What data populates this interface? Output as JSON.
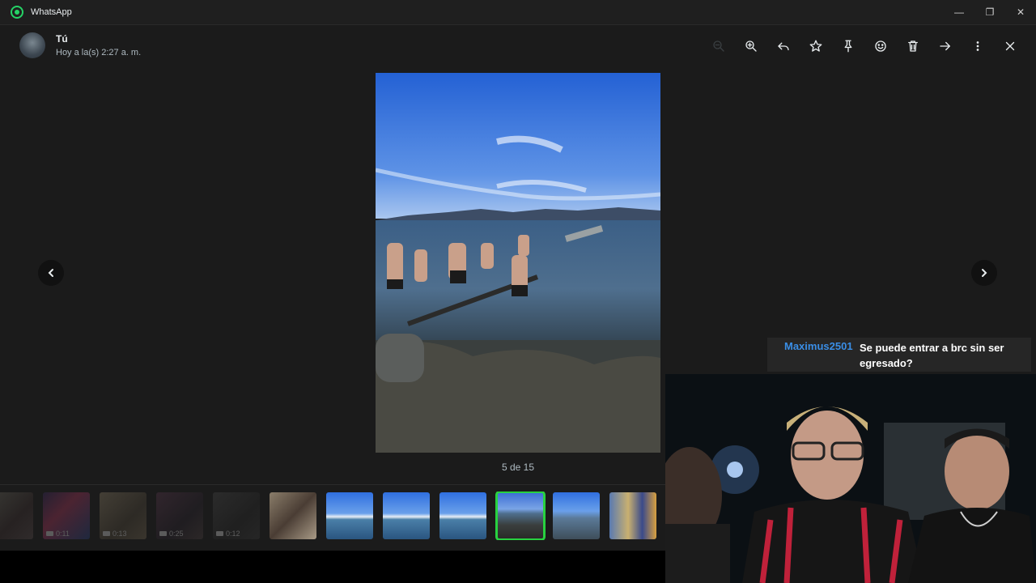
{
  "window": {
    "app_title": "WhatsApp",
    "controls": {
      "minimize": "—",
      "maximize": "❐",
      "close": "✕"
    }
  },
  "header": {
    "sender_name": "Tú",
    "timestamp": "Hoy a la(s) 2:27 a. m."
  },
  "toolbar": {
    "items": [
      "zoom-out",
      "zoom-in",
      "reply",
      "star",
      "pin",
      "react",
      "delete",
      "forward",
      "more",
      "close"
    ]
  },
  "viewer": {
    "counter": "5 de 15"
  },
  "thumbnails": [
    {
      "kind": "video",
      "duration": ""
    },
    {
      "kind": "video",
      "duration": "0:11"
    },
    {
      "kind": "video",
      "duration": "0:13"
    },
    {
      "kind": "video",
      "duration": "0:25"
    },
    {
      "kind": "video",
      "duration": "0:12"
    },
    {
      "kind": "image"
    },
    {
      "kind": "image"
    },
    {
      "kind": "image"
    },
    {
      "kind": "image"
    },
    {
      "kind": "image",
      "selected": true
    },
    {
      "kind": "image"
    },
    {
      "kind": "image"
    }
  ],
  "stream_overlay": {
    "username": "Maximus2501",
    "message": "Se puede entrar a brc sin ser egresado?"
  },
  "colors": {
    "accent_green": "#28d140",
    "username_blue": "#3a8ee6",
    "background": "#1b1b1b"
  }
}
